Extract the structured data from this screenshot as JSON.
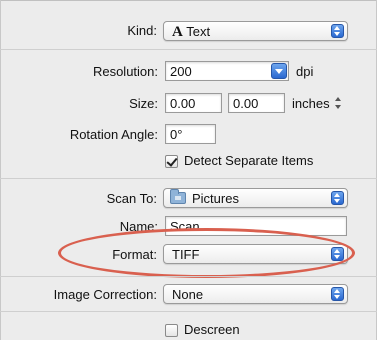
{
  "kind": {
    "label": "Kind:",
    "glyph": "A",
    "value": "Text"
  },
  "resolution": {
    "label": "Resolution:",
    "value": "200",
    "unit": "dpi"
  },
  "size": {
    "label": "Size:",
    "width": "0.00",
    "height": "0.00",
    "unit": "inches"
  },
  "rotation": {
    "label": "Rotation Angle:",
    "value": "0°"
  },
  "detect_separate": {
    "label": "Detect Separate Items",
    "checked": true
  },
  "scan_to": {
    "label": "Scan To:",
    "value": "Pictures",
    "icon": "folder-icon"
  },
  "name": {
    "label": "Name:",
    "value": "Scan"
  },
  "format": {
    "label": "Format:",
    "value": "TIFF"
  },
  "image_correction": {
    "label": "Image Correction:",
    "value": "None"
  },
  "descreen": {
    "label": "Descreen",
    "checked": false
  },
  "colors": {
    "highlight_ring": "#d9604f",
    "popup_arrow_accent": "#2a68d0"
  }
}
